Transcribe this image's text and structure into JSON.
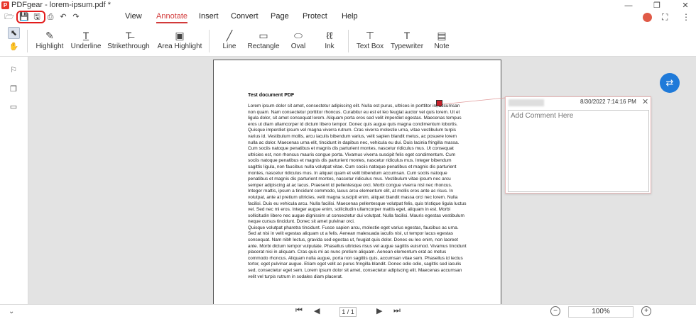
{
  "window": {
    "title": "PDFgear - lorem-ipsum.pdf *",
    "logo_glyph": "P",
    "minimize": "—",
    "maximize": "❐",
    "close": "✕"
  },
  "quick_access": {
    "open": "🗁",
    "save": "💾",
    "save_as": "🖫",
    "print": "⎙",
    "undo": "↶",
    "redo": "↷"
  },
  "menu": {
    "items": [
      "View",
      "Annotate",
      "Insert",
      "Convert",
      "Page",
      "Protect",
      "Help"
    ],
    "active": "Annotate",
    "fullscreen": "⛶",
    "more": "⋮"
  },
  "toolbar": {
    "select_glyph": "⬉",
    "hand_glyph": "✋",
    "tools": [
      {
        "label": "Highlight",
        "glyph": "✎"
      },
      {
        "label": "Underline",
        "glyph": "T̲"
      },
      {
        "label": "Strikethrough",
        "glyph": "T̶"
      },
      {
        "label": "Area Highlight",
        "glyph": "▣"
      },
      {
        "label": "Line",
        "glyph": "╱"
      },
      {
        "label": "Rectangle",
        "glyph": "▭"
      },
      {
        "label": "Oval",
        "glyph": "⬭"
      },
      {
        "label": "Ink",
        "glyph": "ℓℓ"
      },
      {
        "label": "Text Box",
        "glyph": "⊤"
      },
      {
        "label": "Typewriter",
        "glyph": "T"
      },
      {
        "label": "Note",
        "glyph": "▤"
      }
    ]
  },
  "sidebar": {
    "bookmark": "⚐",
    "thumbnails": "❒",
    "comments": "▭",
    "collapse": "⌄"
  },
  "document": {
    "heading": "Test document PDF",
    "paragraphs": [
      "Lorem ipsum dolor sit amet, consectetur adipiscing elit. Nulla est purus, ultrices in porttitor in, accumsan non quam. Nam consectetur porttitor rhoncus. Curabitur eu est et leo feugiat auctor vel quis lorem. Ut et ligula dolor, sit amet consequat lorem. Aliquam porta eros sed velit imperdiet egestas. Maecenas tempus eros ut diam ullamcorper id dictum libero tempor. Donec quis augue quis magna condimentum lobortis. Quisque imperdiet ipsum vel magna viverra rutrum. Cras viverra molestie urna, vitae vestibulum turpis varius id. Vestibulum mollis, arcu iaculis bibendum varius, velit sapien blandit metus, ac posuere lorem nulla ac dolor. Maecenas urna elit, tincidunt in dapibus nec, vehicula eu dui. Duis lacinia fringilla massa. Cum sociis natoque penatibus et magnis dis parturient montes, nascetur ridiculus mus. Ut consequat ultricies est, non rhoncus mauris congue porta. Vivamus viverra suscipit felis eget condimentum. Cum sociis natoque penatibus et magnis dis parturient montes, nascetur ridiculus mus. Integer bibendum sagittis ligula, non faucibus nulla volutpat vitae. Cum sociis natoque penatibus et magnis dis parturient montes, nascetur ridiculus mus. In aliquet quam et velit bibendum accumsan. Cum sociis natoque penatibus et magnis dis parturient montes, nascetur ridiculus mus. Vestibulum vitae ipsum nec arcu semper adipiscing at ac lacus. Praesent id pellentesque orci. Morbi congue viverra nisl nec rhoncus. Integer mattis, ipsum a tincidunt commodo, lacus arcu elementum elit, at mollis eros ante ac risus. In volutpat, ante at pretium ultricies, velit magna suscipit enim, aliquet blandit massa orci nec lorem. Nulla facilisi. Duis eu vehicula arcu. Nulla facilisi. Maecenas pellentesque volutpat felis, quis tristique ligula luctus vel. Sed nec mi eros. Integer augue enim, sollicitudin ullamcorper mattis eget, aliquam in est. Morbi sollicitudin libero nec augue dignissim ut consectetur dui volutpat. Nulla facilisi. Mauris egestas vestibulum neque cursus tincidunt. Donec sit amet pulvinar orci.",
      "Quisque volutpat pharetra tincidunt. Fusce sapien arcu, molestie eget varius egestas, faucibus ac urna. Sed at nisi in velit egestas aliquam ut a felis. Aenean malesuada iaculis nisl, ut tempor lacus egestas consequat. Nam nibh lectus, gravida sed egestas ut, feugiat quis dolor. Donec eu leo enim, non laoreet ante. Morbi dictum tempor vulputate. Phasellus ultricies risus vel augue sagittis euismod. Vivamus tincidunt placerat nisi in aliquam. Cras quis mi ac nunc pretium aliquam. Aenean elementum erat ac metus commodo rhoncus. Aliquam nulla augue, porta non sagittis quis, accumsan vitae sem. Phasellus id lectus tortor, eget pulvinar augue. Etiam eget velit ac purus fringilla blandit. Donec odio odio, sagittis sed iaculis sed, consectetur eget sem. Lorem ipsum dolor sit amet, consectetur adipiscing elit. Maecenas accumsan velit vel turpis rutrum in sodales diam placerat."
    ]
  },
  "comment": {
    "date": "8/30/2022 7:14:16 PM",
    "close": "✕",
    "placeholder": "Add Comment Here"
  },
  "convert_fab": "⇄",
  "navigation": {
    "first": "⏮",
    "prev": "◀",
    "page": "1 / 1",
    "next": "▶",
    "last": "⏭"
  },
  "zoom": {
    "value": "100%",
    "out": "−",
    "in": "+"
  },
  "colors": {
    "accent": "#d23a3a",
    "highlight_ring": "#e21b1b",
    "fab": "#1f7ad9",
    "note_marker": "#c8202a"
  }
}
